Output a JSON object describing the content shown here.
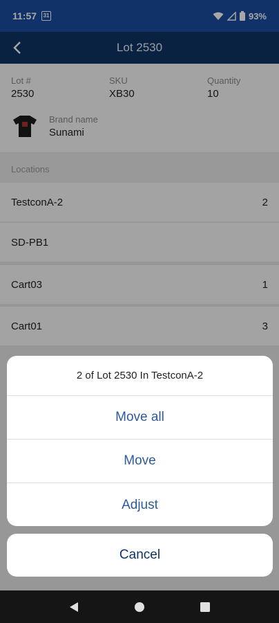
{
  "status_bar": {
    "time": "11:57",
    "calendar_badge": "31",
    "battery": "93%"
  },
  "app_bar": {
    "title": "Lot 2530"
  },
  "info": {
    "lot_label": "Lot #",
    "lot_value": "2530",
    "sku_label": "SKU",
    "sku_value": "XB30",
    "qty_label": "Quantity",
    "qty_value": "10",
    "brand_label": "Brand name",
    "brand_value": "Sunami"
  },
  "locations": {
    "header": "Locations",
    "rows": [
      {
        "name": "TestconA-2",
        "qty": "2"
      },
      {
        "name": "SD-PB1",
        "qty": ""
      },
      {
        "name": "Cart03",
        "qty": "1"
      },
      {
        "name": "Cart01",
        "qty": "3"
      }
    ]
  },
  "action_sheet": {
    "title": "2 of Lot 2530 In TestconA-2",
    "actions": [
      "Move all",
      "Move",
      "Adjust"
    ],
    "cancel": "Cancel"
  },
  "colors": {
    "status_bar": "#1a4ea0",
    "app_bar": "#0e3566",
    "action_text": "#2d5a9c"
  }
}
